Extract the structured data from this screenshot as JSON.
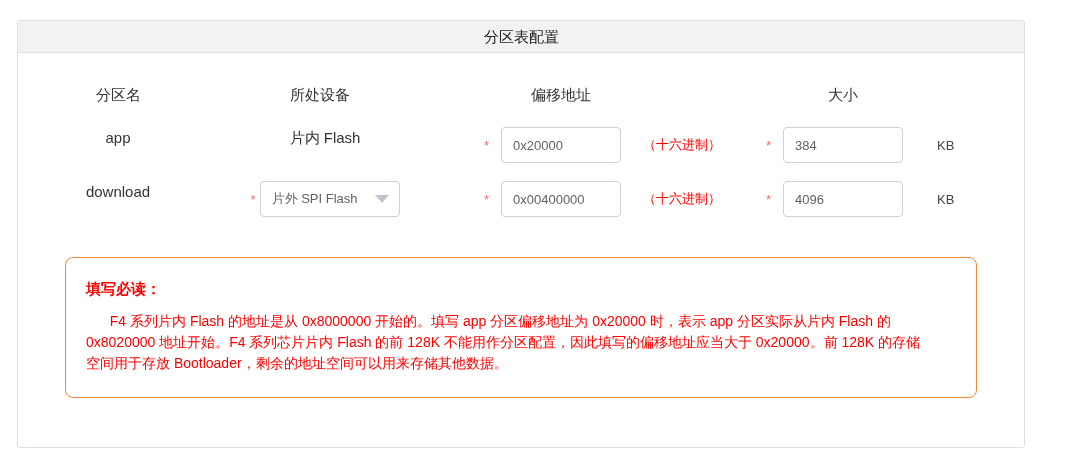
{
  "panel": {
    "title": "分区表配置"
  },
  "columns": [
    "分区名",
    "所处设备",
    "偏移地址",
    "大小"
  ],
  "rows": [
    {
      "name": "app",
      "device": {
        "kind": "text",
        "value": "片内 Flash"
      },
      "offset": {
        "value": "0x20000",
        "mark": "*",
        "hint": "（十六进制）"
      },
      "size": {
        "value": "384",
        "mark": "*",
        "unit": "KB"
      }
    },
    {
      "name": "download",
      "device": {
        "kind": "select",
        "value": "片外 SPI Flash",
        "mark": "*"
      },
      "offset": {
        "value": "0x00400000",
        "mark": "*",
        "hint": "（十六进制）"
      },
      "size": {
        "value": "4096",
        "mark": "*",
        "unit": "KB"
      }
    }
  ],
  "notice": {
    "title": "填写必读：",
    "body": "F4 系列片内 Flash 的地址是从 0x8000000 开始的。填写 app 分区偏移地址为 0x20000 时，表示 app 分区实际从片内 Flash 的 0x8020000 地址开始。F4 系列芯片片内 Flash 的前 128K 不能用作分区配置，因此填写的偏移地址应当大于 0x20000。前 128K 的存储空间用于存放 Bootloader，剩余的地址空间可以用来存储其他数据。"
  }
}
